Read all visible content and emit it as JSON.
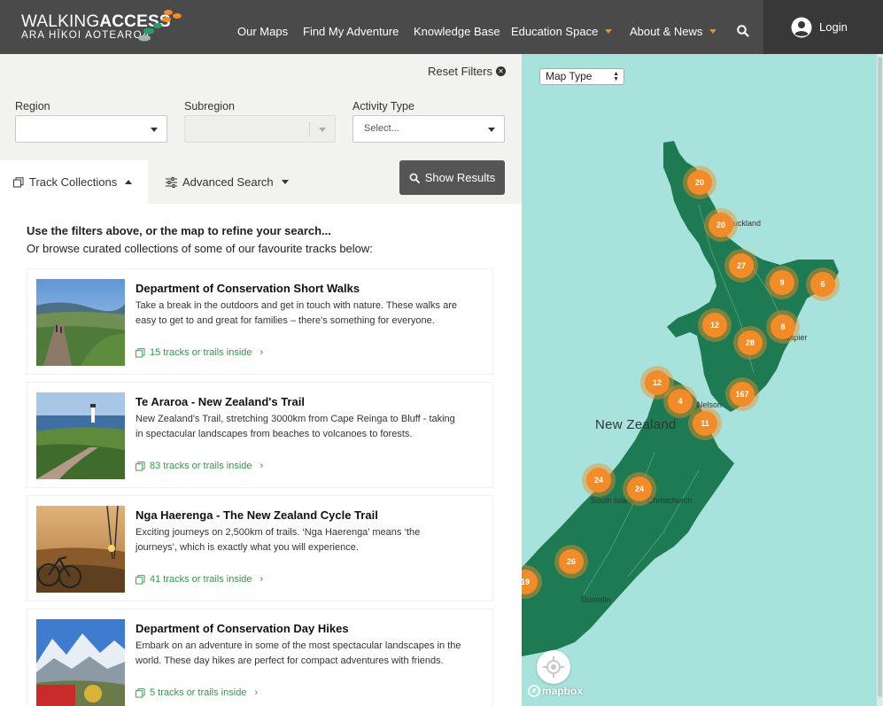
{
  "header": {
    "logo_title_bold": "ACCESS",
    "logo_title_prefix": "WALKING",
    "logo_subtitle": "ARA HĪKOI AOTEAROA",
    "nav": [
      {
        "label": "Our Maps"
      },
      {
        "label": "Find My Adventure"
      },
      {
        "label": "Knowledge Base"
      },
      {
        "label": "Education Space"
      },
      {
        "label": "About & News"
      }
    ],
    "login_label": "Login"
  },
  "filters": {
    "reset_label": "Reset Filters",
    "region_label": "Region",
    "region_value": "",
    "subregion_label": "Subregion",
    "subregion_value": "",
    "activity_label": "Activity Type",
    "activity_placeholder": "Select..."
  },
  "tabs": {
    "collections_label": "Track Collections",
    "advanced_label": "Advanced Search",
    "show_results_label": "Show Results"
  },
  "intro": {
    "line1": "Use the filters above, or the map to refine your search...",
    "line2": "Or browse curated collections of some of our favourite tracks below:"
  },
  "collections": [
    {
      "title": "Department of Conservation Short Walks",
      "description": "Take a break in the outdoors and get in touch with nature. These walks are easy to get to and great for families – there's something for everyone.",
      "link": "15 tracks or trails inside"
    },
    {
      "title": "Te Araroa - New Zealand's Trail",
      "description": "New Zealand's Trail, stretching 3000km from Cape Reinga to Bluff - taking in spectacular landscapes from beaches to volcanoes to forests.",
      "link": "83 tracks or trails inside"
    },
    {
      "title": "Nga Haerenga - The New Zealand Cycle Trail",
      "description": "Exciting journeys on 2,500km of trails. ‘Nga Haerenga’ means ‘the journeys’, which is exactly what you will experience.",
      "link": "41 tracks or trails inside"
    },
    {
      "title": "Department of Conservation Day Hikes",
      "description": "Embark on an adventure in some of the most spectacular landscapes in the world. These day hikes are perfect for compact adventures with friends.",
      "link": "5 tracks or trails inside"
    }
  ],
  "map": {
    "map_type_label": "Map Type",
    "country_label": "New Zealand",
    "places": [
      "South Island",
      "Christchurch",
      "Dunedin",
      "Nelson",
      "Napier",
      "Auckland"
    ],
    "clusters": [
      "20",
      "20",
      "27",
      "9",
      "6",
      "12",
      "28",
      "8",
      "12",
      "4",
      "167",
      "11",
      "24",
      "24",
      "26",
      "19"
    ],
    "attribution": "mapbox",
    "colors": {
      "land": "#1e7a52",
      "water": "#a7e3dc",
      "cluster": "#f28c28"
    }
  }
}
